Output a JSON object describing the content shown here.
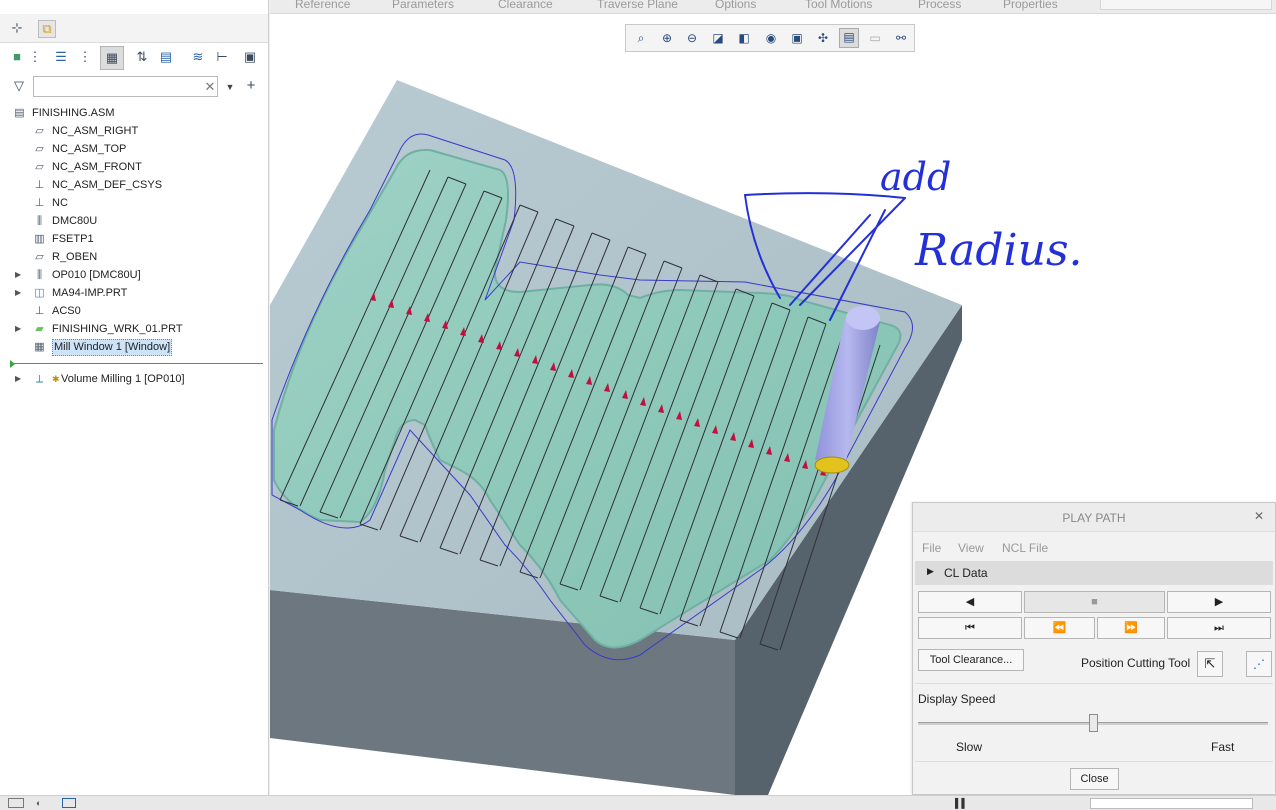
{
  "top_tabs": [
    "Reference",
    "Parameters",
    "Clearance",
    "Traverse Plane",
    "Options",
    "Tool Motions",
    "Process",
    "Properties"
  ],
  "left_panel": {
    "filter": {
      "value": "",
      "placeholder": ""
    },
    "tree": [
      {
        "label": "FINISHING.ASM",
        "icon": "assembly-icon",
        "level": 0,
        "expandable": false
      },
      {
        "label": "NC_ASM_RIGHT",
        "icon": "datum-plane-icon",
        "level": 1,
        "expandable": false
      },
      {
        "label": "NC_ASM_TOP",
        "icon": "datum-plane-icon",
        "level": 1,
        "expandable": false
      },
      {
        "label": "NC_ASM_FRONT",
        "icon": "datum-plane-icon",
        "level": 1,
        "expandable": false
      },
      {
        "label": "NC_ASM_DEF_CSYS",
        "icon": "csys-icon",
        "level": 1,
        "expandable": false
      },
      {
        "label": "NC",
        "icon": "csys-icon",
        "level": 1,
        "expandable": false
      },
      {
        "label": "DMC80U",
        "icon": "machine-icon",
        "level": 1,
        "expandable": false
      },
      {
        "label": "FSETP1",
        "icon": "fixture-icon",
        "level": 1,
        "expandable": false
      },
      {
        "label": "R_OBEN",
        "icon": "datum-plane-icon",
        "level": 1,
        "expandable": false
      },
      {
        "label": "OP010 [DMC80U]",
        "icon": "operation-icon",
        "level": 1,
        "expandable": true
      },
      {
        "label": "MA94-IMP.PRT",
        "icon": "part-icon",
        "level": 1,
        "expandable": true
      },
      {
        "label": "ACS0",
        "icon": "csys-icon",
        "level": 1,
        "expandable": false
      },
      {
        "label": "FINISHING_WRK_01.PRT",
        "icon": "workpiece-icon",
        "level": 1,
        "expandable": true
      },
      {
        "label": "Mill Window 1 [Window]",
        "icon": "mill-window-icon",
        "level": 1,
        "expandable": false,
        "selected": true
      },
      {
        "label": "Volume Milling 1 [OP010]",
        "icon": "volume-milling-icon",
        "level": 1,
        "expandable": true
      }
    ]
  },
  "annotation": {
    "line1": "add",
    "line2": "Radius."
  },
  "play_path": {
    "title": "PLAY PATH",
    "menu": [
      "File",
      "View",
      "NCL File"
    ],
    "section": "CL Data",
    "tool_clearance_label": "Tool Clearance...",
    "position_cutting_tool_label": "Position Cutting Tool",
    "display_speed_label": "Display Speed",
    "speed": {
      "value": 0.5,
      "min_label": "Slow",
      "max_label": "Fast"
    },
    "close_label": "Close"
  }
}
